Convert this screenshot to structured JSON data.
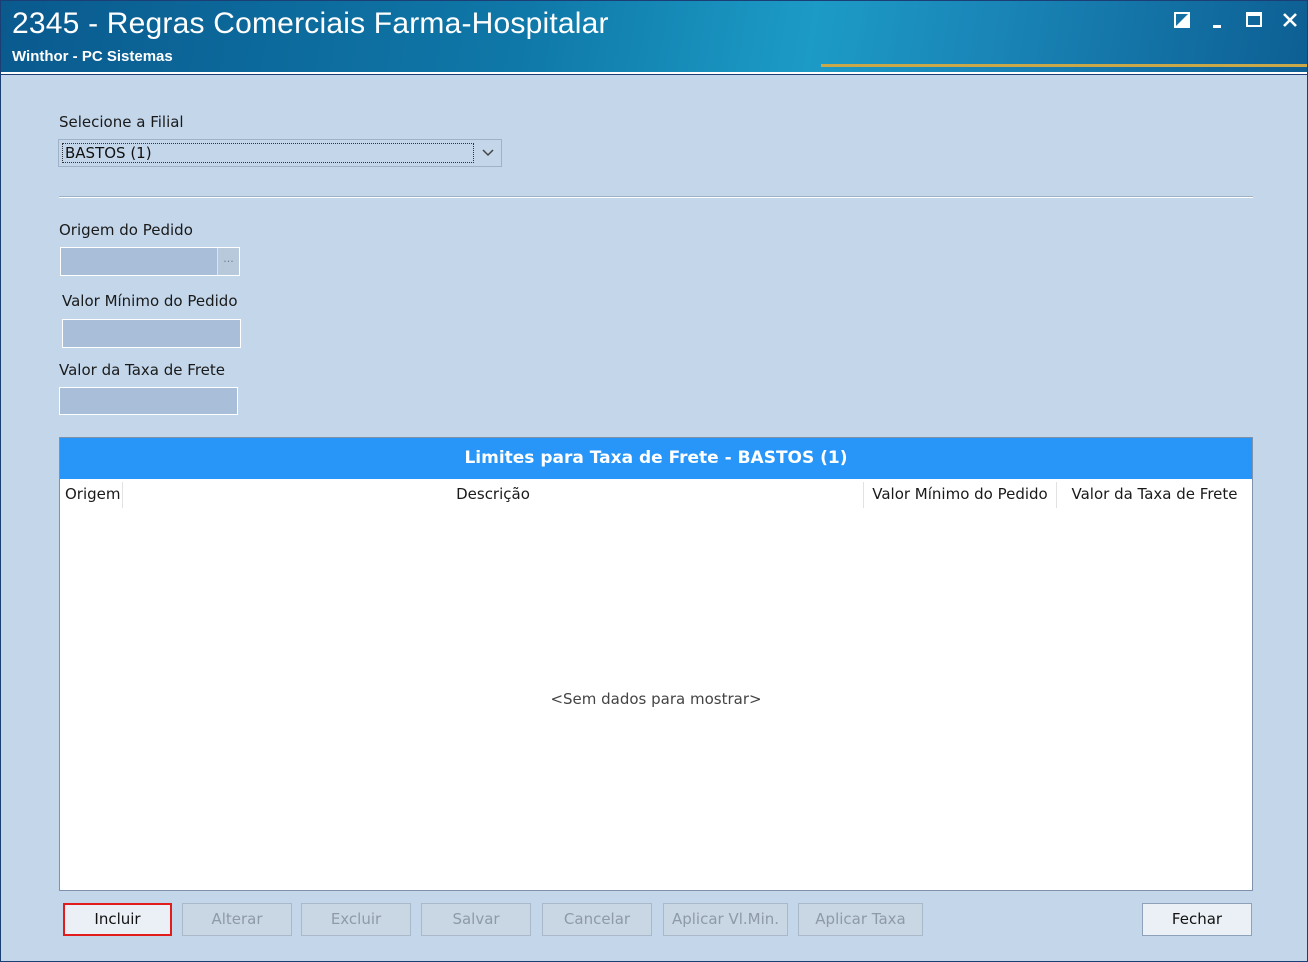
{
  "window": {
    "title": "2345 - Regras Comerciais Farma-Hospitalar",
    "subtitle": "Winthor - PC Sistemas",
    "controls": [
      "restore-icon",
      "minimize-icon",
      "maximize-icon",
      "close-icon"
    ]
  },
  "filial": {
    "label": "Selecione a Filial",
    "selected": "BASTOS (1)"
  },
  "form": {
    "origem_label": "Origem do Pedido",
    "origem_value": "",
    "ellipsis": "...",
    "valor_minimo_label": "Valor Mínimo do Pedido",
    "valor_minimo_value": "",
    "taxa_frete_label": "Valor da Taxa de Frete",
    "taxa_frete_value": ""
  },
  "grid": {
    "title": "Limites para Taxa de Frete - BASTOS (1)",
    "columns": [
      "Origem",
      "Descrição",
      "Valor Mínimo do Pedido",
      "Valor da Taxa de Frete"
    ],
    "rows": [],
    "empty_message": "<Sem dados para mostrar>",
    "title_color": "#2896f8"
  },
  "buttons": {
    "incluir": "Incluir",
    "alterar": "Alterar",
    "excluir": "Excluir",
    "salvar": "Salvar",
    "cancelar": "Cancelar",
    "aplicar_vl_min": "Aplicar Vl.Min.",
    "aplicar_taxa": "Aplicar Taxa",
    "fechar": "Fechar"
  },
  "colors": {
    "background": "#c3d6ea",
    "focus_border": "#e21b1b"
  }
}
